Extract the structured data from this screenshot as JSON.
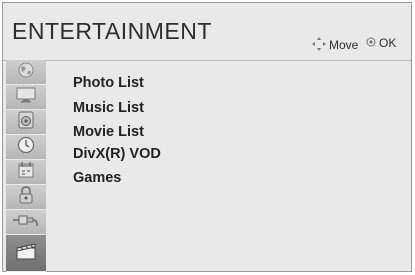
{
  "header": {
    "title": "ENTERTAINMENT",
    "move_label": "Move",
    "ok_label": "OK"
  },
  "sidebar": {
    "icons": [
      "globe-icon",
      "monitor-icon",
      "speaker-icon",
      "clock-icon",
      "calendar-icon",
      "lock-icon",
      "input-cable-icon",
      "entertainment-clapper-icon"
    ],
    "active_index": 7
  },
  "menu": {
    "items": [
      {
        "label": "Photo List"
      },
      {
        "label": "Music List"
      },
      {
        "label": "Movie List"
      },
      {
        "label": "DivX(R) VOD"
      },
      {
        "label": "Games"
      }
    ]
  }
}
